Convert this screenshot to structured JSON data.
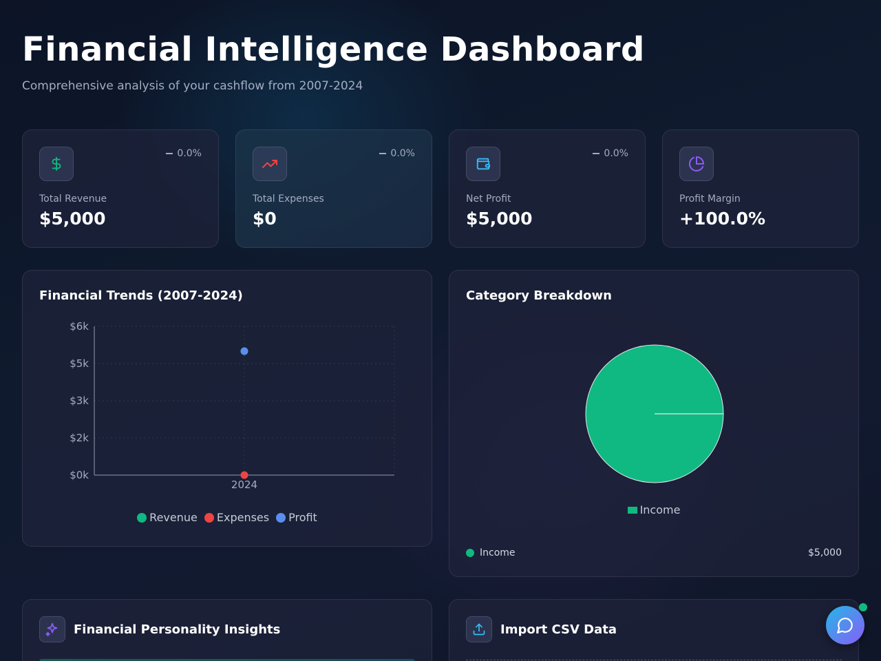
{
  "header": {
    "title": "Financial Intelligence Dashboard",
    "subtitle": "Comprehensive analysis of your cashflow from 2007-2024"
  },
  "stats": [
    {
      "label": "Total Revenue",
      "value": "$5,000",
      "change": "0.0%",
      "icon": "dollar-icon",
      "icon_color": "#10b981"
    },
    {
      "label": "Total Expenses",
      "value": "$0",
      "change": "0.0%",
      "icon": "trending-up-icon",
      "icon_color": "#ef4444"
    },
    {
      "label": "Net Profit",
      "value": "$5,000",
      "change": "0.0%",
      "icon": "wallet-icon",
      "icon_color": "#38bdf8"
    },
    {
      "label": "Profit Margin",
      "value": "+100.0%",
      "change": "",
      "icon": "pie-chart-icon",
      "icon_color": "#8b5cf6"
    }
  ],
  "trends": {
    "title": "Financial Trends (2007-2024)",
    "legend": [
      {
        "name": "Revenue",
        "color": "#10b981"
      },
      {
        "name": "Expenses",
        "color": "#ef4444"
      },
      {
        "name": "Profit",
        "color": "#5b8def"
      }
    ]
  },
  "category": {
    "title": "Category Breakdown",
    "legend_label": "Income",
    "rows": [
      {
        "name": "Income",
        "value": "$5,000",
        "color": "#10b981"
      }
    ]
  },
  "insights": {
    "title": "Financial Personality Insights",
    "icon": "sparkles-icon"
  },
  "import": {
    "title": "Import CSV Data",
    "icon": "upload-icon"
  },
  "chart_data": [
    {
      "type": "scatter",
      "title": "Financial Trends (2007-2024)",
      "x": [
        "2024"
      ],
      "yticks": [
        "$0k",
        "$2k",
        "$3k",
        "$5k",
        "$6k"
      ],
      "ylim": [
        0,
        6000
      ],
      "grid": true,
      "legend_position": "bottom",
      "series": [
        {
          "name": "Revenue",
          "values": [
            5000
          ],
          "color": "#10b981"
        },
        {
          "name": "Expenses",
          "values": [
            0
          ],
          "color": "#ef4444"
        },
        {
          "name": "Profit",
          "values": [
            5000
          ],
          "color": "#5b8def"
        }
      ]
    },
    {
      "type": "pie",
      "title": "Category Breakdown",
      "categories": [
        "Income"
      ],
      "values": [
        5000
      ],
      "colors": [
        "#10b981"
      ],
      "legend_position": "bottom"
    }
  ]
}
